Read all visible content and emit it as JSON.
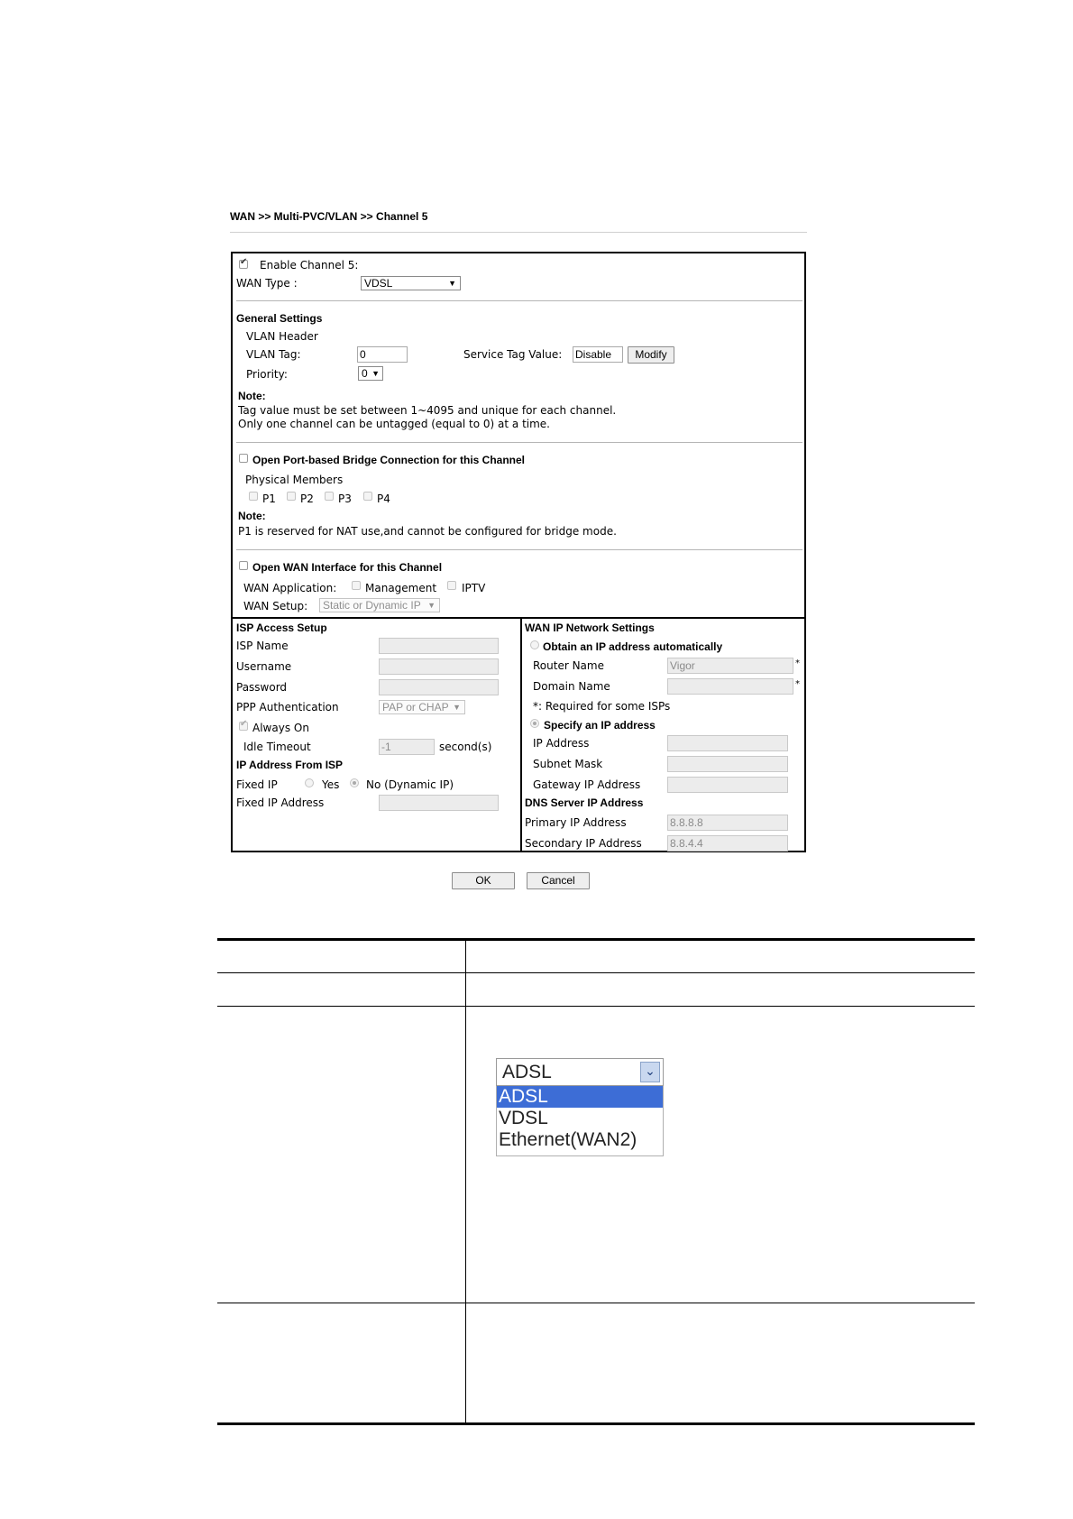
{
  "breadcrumb": "WAN >> Multi-PVC/VLAN >> Channel 5",
  "channel": {
    "enable_label": "Enable Channel 5:",
    "enable_checked": true,
    "wan_type_label": "WAN Type   :",
    "wan_type_value": "VDSL"
  },
  "general": {
    "title": "General Settings",
    "vlan_header": "VLAN Header",
    "vlan_tag_label": "VLAN Tag:",
    "vlan_tag_value": "0",
    "service_tag_label": "Service Tag Value:",
    "service_tag_value": "Disable",
    "modify_label": "Modify",
    "priority_label": "Priority:",
    "priority_value": "0",
    "note_title": "Note:",
    "note_line1": "Tag value must be set between 1~4095 and unique for each channel.",
    "note_line2": "Only one channel can be untagged (equal to 0) at a time."
  },
  "bridge": {
    "title": "Open Port-based Bridge Connection for this Channel",
    "physical_members": "Physical Members",
    "ports": [
      "P1",
      "P2",
      "P3",
      "P4"
    ],
    "note_title": "Note:",
    "note_text": "P1 is reserved for NAT use,and cannot be configured for bridge mode."
  },
  "wan_interface": {
    "title": "Open WAN Interface for this Channel",
    "application_label": "WAN Application:",
    "app_management": "Management",
    "app_iptv": "IPTV",
    "setup_label": "WAN Setup:",
    "setup_value": "Static or Dynamic IP"
  },
  "isp": {
    "title": "ISP Access Setup",
    "isp_name": "ISP Name",
    "username": "Username",
    "password": "Password",
    "ppp_auth_label": "PPP Authentication",
    "ppp_auth_value": "PAP or CHAP",
    "always_on": "Always On",
    "idle_timeout": "Idle Timeout",
    "idle_value": "-1",
    "seconds": "second(s)",
    "ip_from_isp": "IP Address From ISP",
    "fixed_ip": "Fixed IP",
    "yes": "Yes",
    "no": "No (Dynamic IP)",
    "fixed_ip_address": "Fixed IP Address"
  },
  "wanip": {
    "title": "WAN IP Network Settings",
    "obtain_auto": "Obtain an IP address automatically",
    "router_name": "Router Name",
    "router_name_value": "Vigor",
    "domain_name": "Domain Name",
    "star": "*",
    "required_note": "*: Required for some ISPs",
    "specify": "Specify an IP address",
    "ip_address": "IP Address",
    "subnet_mask": "Subnet Mask",
    "gateway": "Gateway IP Address",
    "dns_title": "DNS Server IP Address",
    "primary": "Primary IP Address",
    "primary_value": "8.8.8.8",
    "secondary": "Secondary IP Address",
    "secondary_value": "8.8.4.4"
  },
  "actions": {
    "ok": "OK",
    "cancel": "Cancel"
  },
  "dropdown_example": {
    "selected": "ADSL",
    "options": [
      "ADSL",
      "VDSL",
      "Ethernet(WAN2)"
    ]
  },
  "colors": {
    "highlight": "#3d6dd6",
    "chevron_bg": "#c9d8ef"
  }
}
